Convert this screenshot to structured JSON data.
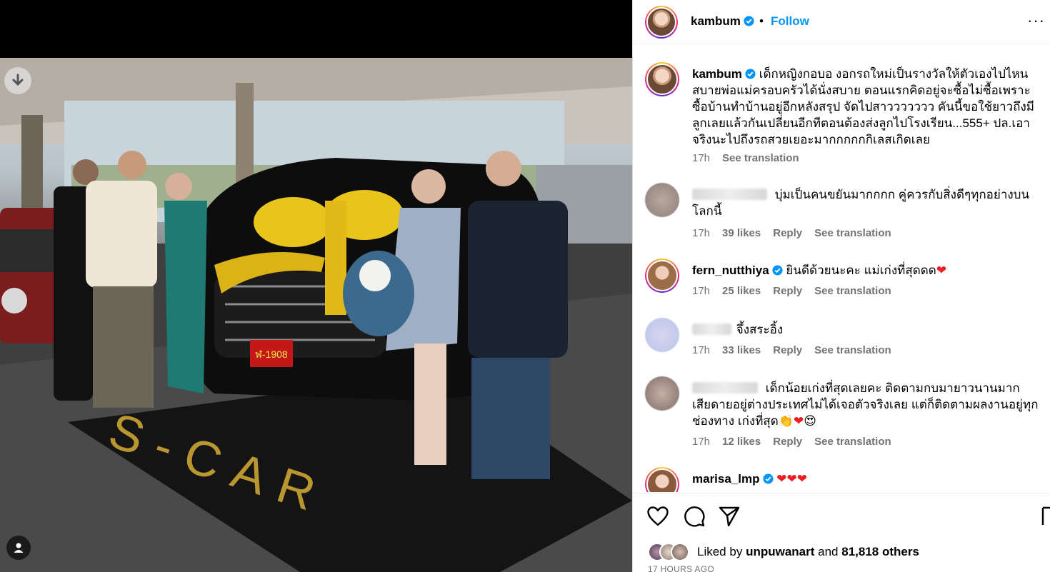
{
  "post": {
    "author": "kambum",
    "follow_label": "Follow",
    "dot": "•",
    "more_label": "···",
    "caption": "เด็กหญิงกอบอ งอกรถใหม่เป็นรางวัลให้ตัวเองไปไหนสบายพ่อแม่ครอบครัวได้นั่งสบาย ตอนแรกคิดอยู่จะซื้อไม่ซื้อเพราะซื้อบ้านทำบ้านอยู่อีกหลังสรุป จัดไปสาววววววว คันนี้ขอใช้ยาวถึงมีลูกเลยแล้วกันเปลี่ยนอีกทีตอนต้องส่งลูกไปโรงเรียน...555+ ปล.เอาจริงนะไปถึงรถสวยเยอะมากกกกกกิเลสเกิดเลย",
    "caption_time": "17h",
    "see_translation": "See translation",
    "plate_text": "ฬ-1908"
  },
  "comments": [
    {
      "user": "",
      "text": "บุ่มเป็นคนขยันมากกกก คู่ควรกับสิ่งดีๆทุกอย่างบนโลกนี้",
      "time": "17h",
      "likes": "39 likes",
      "reply": "Reply",
      "translate": "See translation"
    },
    {
      "user": "fern_nutthiya",
      "text": "ยินดีด้วยนะคะ แม่เก่งที่สุดดด",
      "time": "17h",
      "likes": "25 likes",
      "reply": "Reply",
      "translate": "See translation"
    },
    {
      "user": "",
      "text": "จึ้งสระอิ้ง",
      "time": "17h",
      "likes": "33 likes",
      "reply": "Reply",
      "translate": "See translation"
    },
    {
      "user": "",
      "text": "เด็กน้อยเก่งที่สุดเลยคะ ติดตามกบมายาวนานมากเสียดายอยู่ต่างประเทศไม่ได้เจอตัวจริงเลย แต่ก็ติดตามผลงานอยู่ทุกช่องทาง เก่งที่สุด",
      "time": "17h",
      "likes": "12 likes",
      "reply": "Reply",
      "translate": "See translation"
    },
    {
      "user": "marisa_lmp",
      "text": "",
      "time": "",
      "likes": "",
      "reply": "",
      "translate": ""
    }
  ],
  "likes": {
    "prefix": "Liked by",
    "user": "unpuwanart",
    "connector": "and",
    "others": "81,818 others"
  },
  "time_ago": "17 HOURS AGO",
  "colors": {
    "follow_blue": "#0095f6",
    "verified_blue": "#0095f6",
    "heart_red": "#ed1d24",
    "muted": "#737373"
  },
  "icons": [
    "download-icon",
    "verified-badge-icon",
    "more-options-icon",
    "heart-icon",
    "comment-icon",
    "share-icon",
    "user-tag-icon"
  ]
}
